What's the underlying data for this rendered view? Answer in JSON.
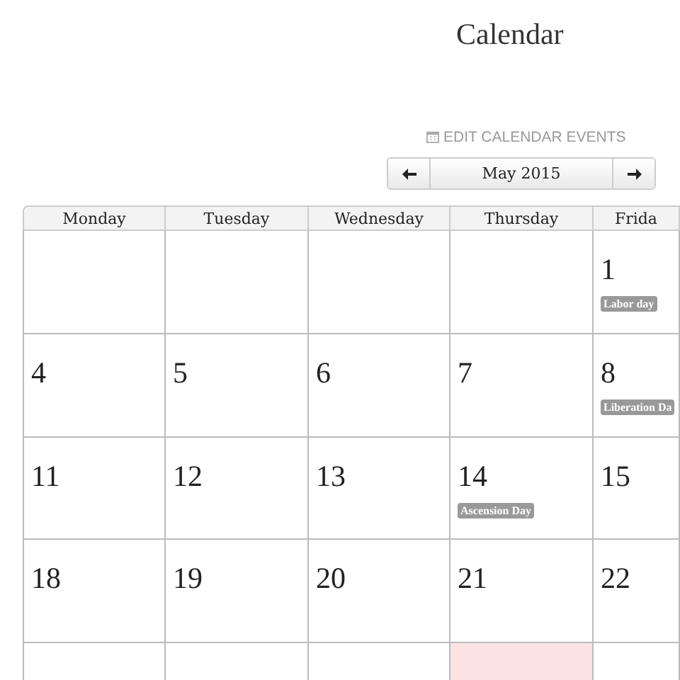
{
  "title": "Calendar",
  "edit_link": {
    "label": "EDIT CALENDAR EVENTS"
  },
  "nav": {
    "month": "May 2015"
  },
  "weekdays": [
    "Monday",
    "Tuesday",
    "Wednesday",
    "Thursday",
    "Frida"
  ],
  "weeks": [
    {
      "days": [
        {
          "today": false
        },
        {
          "today": false
        },
        {
          "today": false
        },
        {
          "today": false
        },
        {
          "number": "1",
          "today": false,
          "events": [
            "Labor day"
          ]
        }
      ]
    },
    {
      "days": [
        {
          "number": "4",
          "today": false
        },
        {
          "number": "5",
          "today": false
        },
        {
          "number": "6",
          "today": false
        },
        {
          "number": "7",
          "today": false
        },
        {
          "number": "8",
          "today": false,
          "events": [
            "Liberation Da"
          ]
        }
      ]
    },
    {
      "days": [
        {
          "number": "11",
          "today": false
        },
        {
          "number": "12",
          "today": false
        },
        {
          "number": "13",
          "today": false
        },
        {
          "number": "14",
          "today": false,
          "events": [
            "Ascension Day"
          ]
        },
        {
          "number": "15",
          "today": false
        }
      ]
    },
    {
      "days": [
        {
          "number": "18",
          "today": false
        },
        {
          "number": "19",
          "today": false
        },
        {
          "number": "20",
          "today": false
        },
        {
          "number": "21",
          "today": false
        },
        {
          "number": "22",
          "today": false
        }
      ]
    },
    {
      "days": [
        {
          "today": false
        },
        {
          "today": false
        },
        {
          "today": false
        },
        {
          "today": true
        },
        {
          "today": false
        }
      ]
    }
  ]
}
